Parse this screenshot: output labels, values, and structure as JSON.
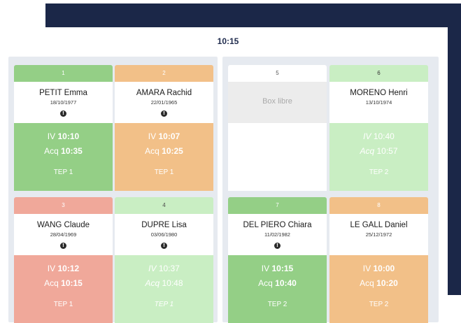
{
  "header": {
    "clock": "10:15"
  },
  "boxes": [
    {
      "number": "1",
      "name": "PETIT Emma",
      "dob": "18/10/1977",
      "iv_label": "IV",
      "iv_time": "10:10",
      "acq_label": "Acq",
      "acq_time": "10:35",
      "tep": "TEP 1",
      "status_color": "#94cf86"
    },
    {
      "number": "2",
      "name": "AMARA Rachid",
      "dob": "22/01/1965",
      "iv_label": "IV",
      "iv_time": "10:07",
      "acq_label": "Acq",
      "acq_time": "10:25",
      "tep": "TEP 1",
      "status_color": "#f2c088"
    },
    {
      "number": "3",
      "name": "WANG Claude",
      "dob": "28/04/1969",
      "iv_label": "IV",
      "iv_time": "10:12",
      "acq_label": "Acq",
      "acq_time": "10:15",
      "tep": "TEP 1",
      "status_color": "#f0a89a"
    },
    {
      "number": "4",
      "name": "DUPRE Lisa",
      "dob": "03/06/1980",
      "iv_label": "IV",
      "iv_time": "10:37",
      "acq_label": "Acq",
      "acq_time": "10:48",
      "tep": "TEP 1",
      "status_color": "#c9eec3"
    },
    {
      "number": "5",
      "free_label": "Box libre"
    },
    {
      "number": "6",
      "name": "MORENO Henri",
      "dob": "13/10/1974",
      "iv_label": "IV",
      "iv_time": "10:40",
      "acq_label": "Acq",
      "acq_time": "10:57",
      "tep": "TEP 2",
      "status_color": "#c9eec3"
    },
    {
      "number": "7",
      "name": "DEL PIERO Chiara",
      "dob": "11/02/1982",
      "iv_label": "IV",
      "iv_time": "10:15",
      "acq_label": "Acq",
      "acq_time": "10:40",
      "tep": "TEP 2",
      "status_color": "#94cf86"
    },
    {
      "number": "8",
      "name": "LE GALL Daniel",
      "dob": "25/12/1972",
      "iv_label": "IV",
      "iv_time": "10:00",
      "acq_label": "Acq",
      "acq_time": "10:20",
      "tep": "TEP 2",
      "status_color": "#f2c088"
    }
  ],
  "icons": {
    "info": "info-icon"
  },
  "colors": {
    "navy": "#1b2748",
    "panel": "#e6eaf0"
  }
}
